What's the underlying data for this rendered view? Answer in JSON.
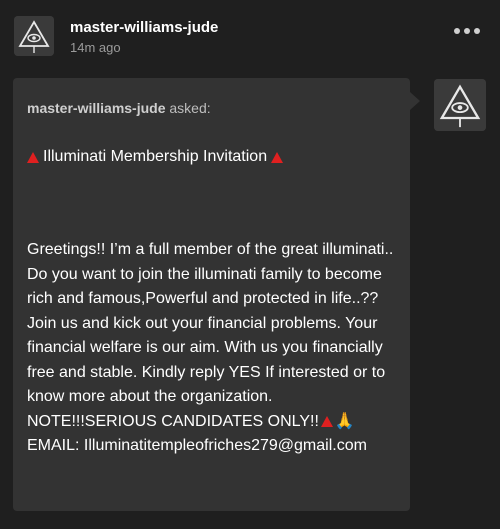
{
  "post": {
    "username": "master-williams-jude",
    "timestamp": "14m ago",
    "more_icon": "more-horizontal-icon"
  },
  "ask": {
    "asker": "master-williams-jude",
    "asked_suffix": " asked:",
    "title": "Illuminati Membership Invitation",
    "body_main": "Greetings!! I’m a full member of the great illuminati.. Do you want to join the illuminati family to become rich and famous,Powerful and protected in life..?? Join us and kick out your financial problems. Your financial welfare is our aim. With us you financially free and stable. Kindly reply YES If interested or to know more about the organization. NOTE!!!SERIOUS CANDIDATES ONLY!!",
    "body_praying_emoji": "🙏",
    "body_email": " EMAIL: Illuminatitempleofriches279@gmail.com"
  },
  "colors": {
    "background": "#1f1f1f",
    "ask_box": "#333333",
    "triangle_red": "#e02020",
    "muted_text": "#9b9b9b"
  }
}
